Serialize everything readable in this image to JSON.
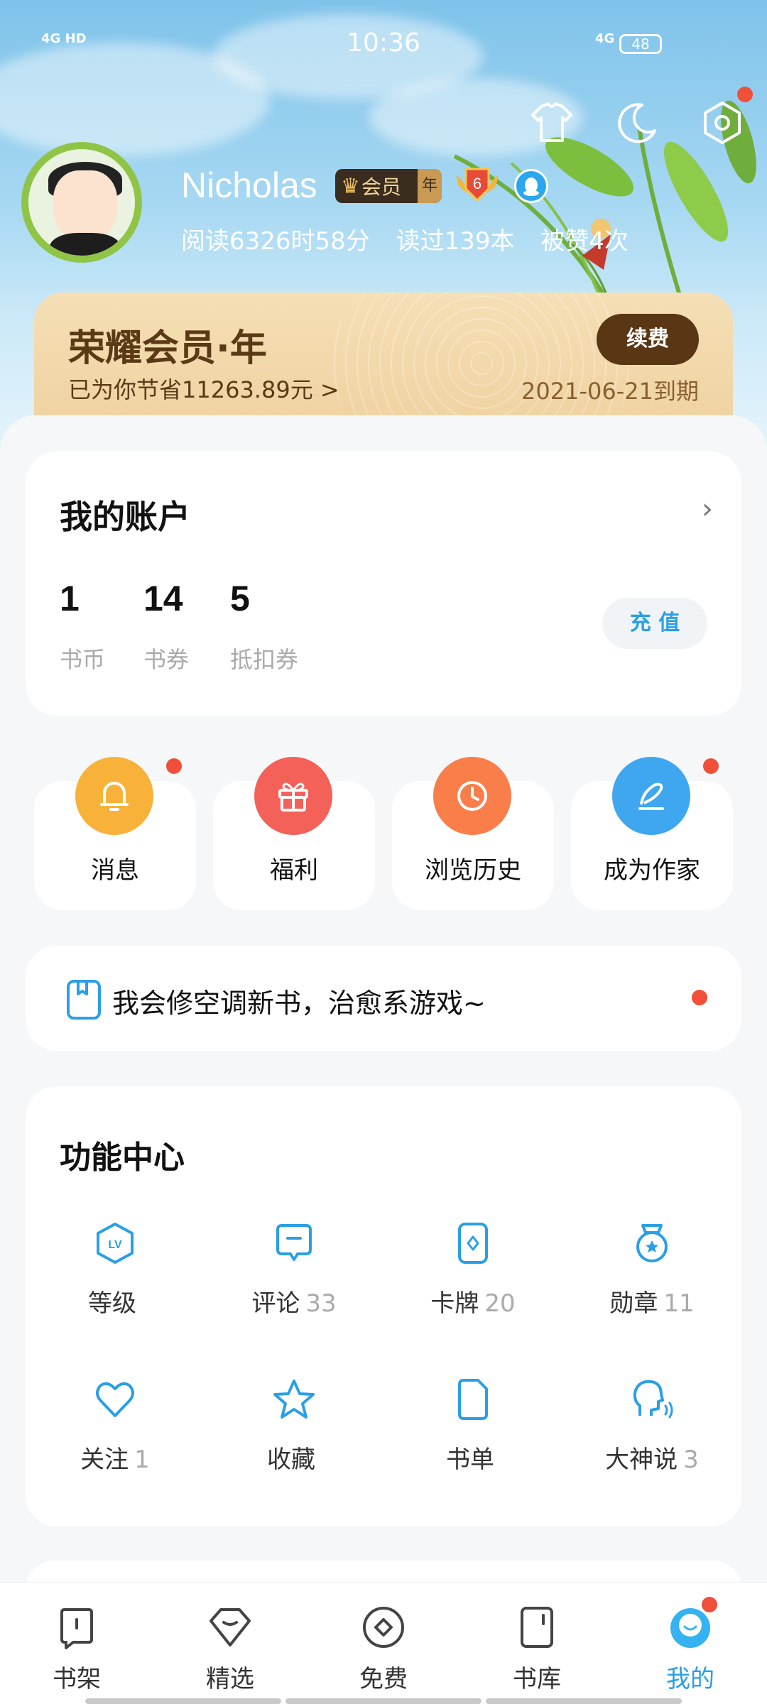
{
  "status_bar": {
    "time": "10:36",
    "signal_left": "4G HD",
    "signal_right": "4G",
    "battery": "48"
  },
  "profile": {
    "name": "Nicholas",
    "vip_badge": "会员",
    "vip_badge_suffix": "年",
    "level": "6",
    "stats": [
      "阅读6326时58分",
      "读过139本",
      "被赞4次"
    ]
  },
  "top_icons": [
    "shirt-icon",
    "moon-icon",
    "settings-icon"
  ],
  "vip_card": {
    "title": "荣耀会员·年",
    "savings": "已为你节省11263.89元 >",
    "renew": "续费",
    "expire": "2021-06-21到期"
  },
  "account": {
    "title": "我的账户",
    "chevron": "›",
    "items": [
      {
        "value": "1",
        "label": "书币"
      },
      {
        "value": "14",
        "label": "书券"
      },
      {
        "value": "5",
        "label": "抵扣券"
      }
    ],
    "topup": "充 值"
  },
  "quick_actions": [
    {
      "label": "消息",
      "icon": "bell-icon",
      "color": "#f8b23a"
    },
    {
      "label": "福利",
      "icon": "gift-icon",
      "color": "#f46159"
    },
    {
      "label": "浏览历史",
      "icon": "clock-icon",
      "color": "#f97e4a"
    },
    {
      "label": "成为作家",
      "icon": "pen-icon",
      "color": "#3fa6f0"
    }
  ],
  "banner": {
    "text": "我会修空调新书，治愈系游戏~"
  },
  "function_center": {
    "title": "功能中心",
    "items": [
      {
        "label": "等级",
        "count": ""
      },
      {
        "label": "评论",
        "count": "33"
      },
      {
        "label": "卡牌",
        "count": "20"
      },
      {
        "label": "勋章",
        "count": "11"
      },
      {
        "label": "关注",
        "count": "1"
      },
      {
        "label": "收藏",
        "count": ""
      },
      {
        "label": "书单",
        "count": ""
      },
      {
        "label": "大神说",
        "count": "3"
      }
    ]
  },
  "tabs": [
    {
      "label": "书架"
    },
    {
      "label": "精选"
    },
    {
      "label": "免费"
    },
    {
      "label": "书库"
    },
    {
      "label": "我的"
    }
  ],
  "colors": {
    "accent": "#2a9fe6",
    "badge_red": "#f0503a",
    "vip_brown": "#5a3714"
  }
}
